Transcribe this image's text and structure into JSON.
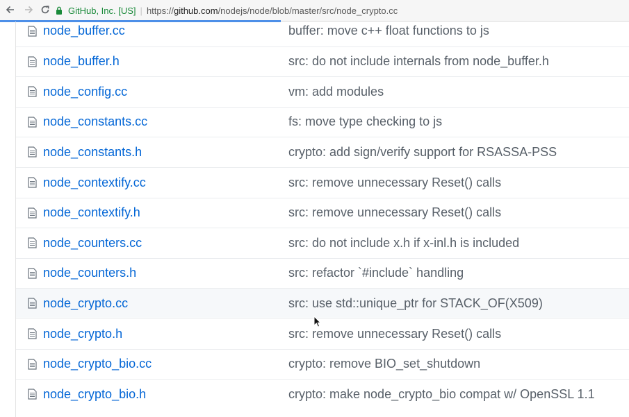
{
  "browser": {
    "site_name": "GitHub, Inc. [US]",
    "separator": "|",
    "url_scheme": "https://",
    "url_host": "github.com",
    "url_path": "/nodejs/node/blob/master/src/node_crypto.cc"
  },
  "colors": {
    "link": "#0366d6",
    "message": "#586069",
    "secure": "#1a8a3a",
    "progress": "#4d8fe8"
  },
  "files": [
    {
      "name": "node_buffer.cc",
      "message": "buffer: move c++ float functions to js"
    },
    {
      "name": "node_buffer.h",
      "message": "src: do not include internals from node_buffer.h"
    },
    {
      "name": "node_config.cc",
      "message": "vm: add modules"
    },
    {
      "name": "node_constants.cc",
      "message": "fs: move type checking to js"
    },
    {
      "name": "node_constants.h",
      "message": "crypto: add sign/verify support for RSASSA-PSS"
    },
    {
      "name": "node_contextify.cc",
      "message": "src: remove unnecessary Reset() calls"
    },
    {
      "name": "node_contextify.h",
      "message": "src: remove unnecessary Reset() calls"
    },
    {
      "name": "node_counters.cc",
      "message": "src: do not include x.h if x-inl.h is included"
    },
    {
      "name": "node_counters.h",
      "message": "src: refactor `#include` handling"
    },
    {
      "name": "node_crypto.cc",
      "message": "src: use std::unique_ptr for STACK_OF(X509)"
    },
    {
      "name": "node_crypto.h",
      "message": "src: remove unnecessary Reset() calls"
    },
    {
      "name": "node_crypto_bio.cc",
      "message": "crypto: remove BIO_set_shutdown"
    },
    {
      "name": "node_crypto_bio.h",
      "message": "crypto: make node_crypto_bio compat w/ OpenSSL 1.1"
    }
  ]
}
